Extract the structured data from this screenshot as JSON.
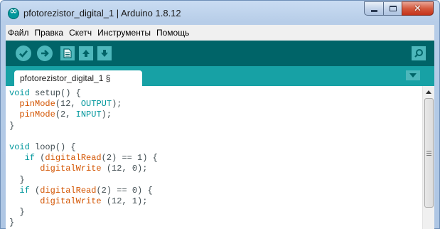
{
  "window": {
    "title": "pfotorezistor_digital_1 | Arduino 1.8.12",
    "icon": "arduino-infinity-icon"
  },
  "menu": [
    "Файл",
    "Правка",
    "Скетч",
    "Инструменты",
    "Помощь"
  ],
  "toolbar": {
    "buttons": [
      "verify-icon",
      "upload-icon",
      "new-icon",
      "open-icon",
      "save-icon"
    ],
    "right_button": "serial-monitor-icon"
  },
  "tab": {
    "label": "pfotorezistor_digital_1 §"
  },
  "editor": {
    "lines": [
      "void setup() {",
      "  pinMode(12, OUTPUT);",
      "  pinMode(2, INPUT);",
      "}",
      "",
      "void loop() {",
      "   if (digitalRead(2) == 1) {",
      "      digitalWrite (12, 0);",
      "  }",
      "  if (digitalRead(2) == 0) {",
      "      digitalWrite (12, 1);",
      "  }",
      "}"
    ]
  },
  "colors": {
    "toolbar": "#006468",
    "tabbar": "#17a1a5",
    "button": "#4db7bb",
    "keyword": "#00979c",
    "function": "#d35400"
  }
}
